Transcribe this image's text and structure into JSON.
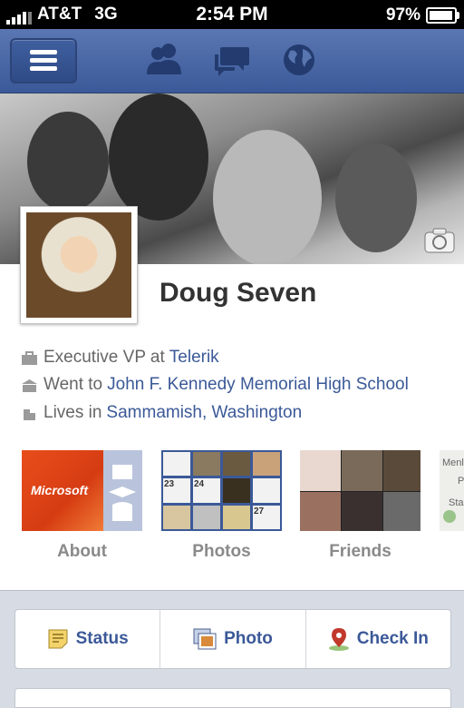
{
  "status_bar": {
    "carrier": "AT&T",
    "network": "3G",
    "time": "2:54 PM",
    "battery": "97%",
    "battery_level": 0.97
  },
  "navbar": {
    "icons": [
      "menu-icon",
      "friends-icon",
      "messages-icon",
      "globe-icon"
    ]
  },
  "profile": {
    "name": "Doug Seven",
    "info": [
      {
        "icon": "briefcase-icon",
        "prefix": "Executive VP at",
        "link": "Telerik"
      },
      {
        "icon": "school-icon",
        "prefix": "Went to",
        "link": "John F. Kennedy Memorial High School"
      },
      {
        "icon": "building-icon",
        "prefix": "Lives in",
        "link": "Sammamish, Washington"
      }
    ]
  },
  "tiles": [
    {
      "label": "About",
      "brand": "Microsoft"
    },
    {
      "label": "Photos",
      "numbers": [
        "23",
        "24",
        "27"
      ]
    },
    {
      "label": "Friends"
    },
    {
      "label": "",
      "partial_text": [
        "Menlo",
        "P",
        "Sta"
      ]
    }
  ],
  "actions": [
    {
      "label": "Status",
      "icon": "note-icon"
    },
    {
      "label": "Photo",
      "icon": "photo-icon"
    },
    {
      "label": "Check In",
      "icon": "location-pin-icon"
    }
  ],
  "colors": {
    "brand_blue": "#3b5998",
    "link": "#3b5998",
    "status_bar": "#000000"
  }
}
